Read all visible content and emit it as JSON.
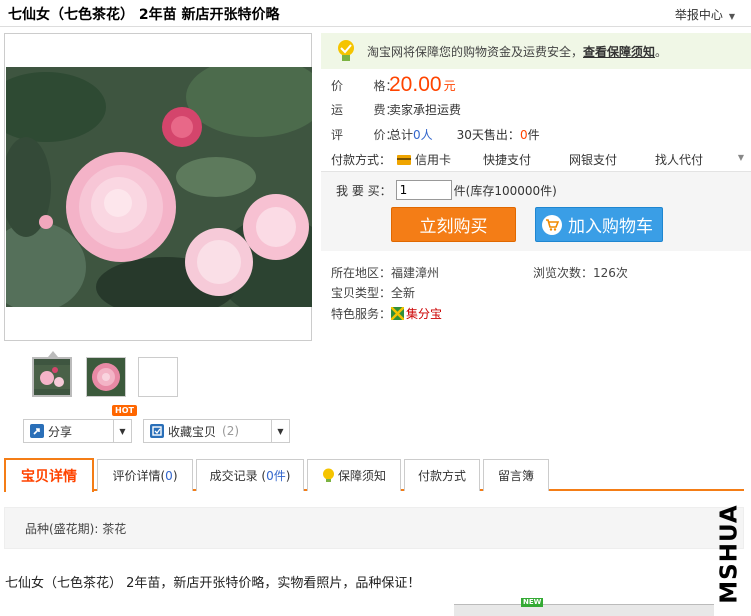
{
  "page": {
    "title": "七仙女（七色茶花） 2年苗 新店开张特价略",
    "report": "举报中心"
  },
  "guarantee": {
    "text": "淘宝网将保障您的购物资金及运费安全，",
    "link": "查看保障须知",
    "period": "。"
  },
  "price": {
    "label": "价        格：",
    "value": "20.00",
    "unit": "元"
  },
  "shipping": {
    "label": "运        费：",
    "value": "卖家承担运费"
  },
  "review": {
    "label": "评        价：",
    "total_prefix": "总计",
    "total_count": "0人",
    "sold_prefix": "30天售出：",
    "sold_count": "0",
    "sold_unit": "件"
  },
  "payment": {
    "label": "付款方式：",
    "options": [
      "信用卡",
      "快捷支付",
      "网银支付",
      "找人代付"
    ]
  },
  "buy": {
    "qty_label": "我 要 买：",
    "qty_value": "1",
    "qty_unit": "件",
    "stock_text": "(库存100000件)",
    "buy_now": "立刻购买",
    "add_cart": "加入购物车"
  },
  "info": {
    "location_label": "所在地区：",
    "location": "福建漳州",
    "views_label": "浏览次数：",
    "views": "126次",
    "type_label": "宝贝类型：",
    "type": "全新",
    "service_label": "特色服务：",
    "service": "集分宝"
  },
  "actions": {
    "share": "分享",
    "hot": "HOT",
    "favorite": "收藏宝贝",
    "favorite_count": "(2)"
  },
  "tabs": [
    "宝贝详情",
    "评价详情(",
    "0",
    ")",
    "成交记录 (",
    "0件",
    ")",
    "保障须知",
    "付款方式",
    "留言簿"
  ],
  "attributes": {
    "text": "品种(盛花期): 茶花"
  },
  "description": "七仙女（七色茶花） 2年苗，新店开张特价略，实物看照片，品种保证！",
  "watermark": "MSHUA",
  "bottom_badge": "NEW",
  "colors": {
    "accent": "#f47d16",
    "price": "#ff4400",
    "link_blue": "#3366cc",
    "cart_blue": "#3a9ee6"
  }
}
